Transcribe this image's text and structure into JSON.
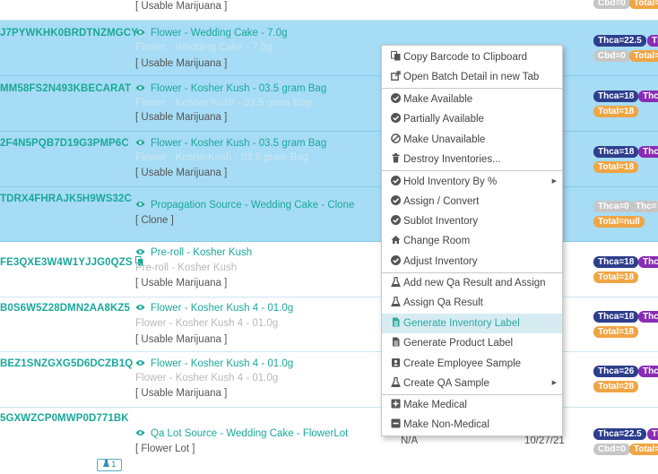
{
  "rows": [
    {
      "barcode": "",
      "name": "",
      "sub": "",
      "category": "[ Usable Marijuana ]",
      "selected": false,
      "badges": [
        {
          "text": "Cbd=0",
          "color": "grey"
        },
        {
          "text": "Total=",
          "color": "orange"
        }
      ]
    },
    {
      "barcode": "J7PYWKHK0BRDTNZMGCY",
      "name": "Flower - Wedding Cake - 7.0g",
      "sub": "Flower - Wedding Cake - 7.0g",
      "category": "[ Usable Marijuana ]",
      "selected": true,
      "badges": [
        {
          "text": "Thca=22.5",
          "color": "navy"
        },
        {
          "text": "Th",
          "color": "purple"
        },
        {
          "text": "Cbd=0",
          "color": "grey"
        },
        {
          "text": "Total=",
          "color": "orange"
        }
      ]
    },
    {
      "barcode": "MM58FS2N493KBECARAT",
      "name": "Flower - Kosher Kush - 03.5 gram Bag",
      "sub": "Flower - Kosher Kush - 03.5 gram Bag",
      "category": "[ Usable Marijuana ]",
      "selected": true,
      "badges": [
        {
          "text": "Thca=18",
          "color": "navy"
        },
        {
          "text": "Thc",
          "color": "purple"
        },
        {
          "text": "Total=18",
          "color": "orange"
        }
      ]
    },
    {
      "barcode": "2F4N5PQB7D19G3PMP6C",
      "name": "Flower - Kosher Kush - 03.5 gram Bag",
      "sub": "Flower - KosherKush - 03.5 gram Bag",
      "category": "[ Usable Marijuana ]",
      "selected": true,
      "badges": [
        {
          "text": "Thca=18",
          "color": "navy"
        },
        {
          "text": "Thc",
          "color": "purple"
        },
        {
          "text": "Total=18",
          "color": "orange"
        }
      ]
    },
    {
      "barcode": "TDRX4FHRAJK5H9WS32C",
      "name": "Propagation Source - Wedding Cake - Clone",
      "sub": "",
      "category": "[ Clone ]",
      "selected": true,
      "badges": [
        {
          "text": "Thca=0",
          "color": "grey"
        },
        {
          "text": "Thc=",
          "color": "grey"
        },
        {
          "text": "Total=null",
          "color": "orange"
        }
      ]
    },
    {
      "barcode": "FE3QXE3W4W1YJJG0QZS",
      "name": "Pre-roll - Kosher Kush",
      "sub": "Pre-roll - Kosher Kush",
      "category": "[ Usable Marijuana ]",
      "selected": false,
      "badges": [
        {
          "text": "Thca=18",
          "color": "navy"
        },
        {
          "text": "Thc",
          "color": "purple"
        },
        {
          "text": "Total=18",
          "color": "orange"
        }
      ]
    },
    {
      "barcode": "B0S6W5Z28DMN2AA8KZ5",
      "name": "Flower - Kosher Kush 4 - 01.0g",
      "sub": "Flower - Kosher Kush 4 - 01.0g",
      "category": "[ Usable Marijuana ]",
      "selected": false,
      "badges": [
        {
          "text": "Thca=18",
          "color": "navy"
        },
        {
          "text": "Thc",
          "color": "purple"
        },
        {
          "text": "Total=18",
          "color": "orange"
        }
      ]
    },
    {
      "barcode": "BEZ1SNZGXG5D6DCZB1Q",
      "name": "Flower - Kosher Kush 4 - 01.0g",
      "sub": "Flower - Kosher Kush 4 - 01.0g",
      "category": "[ Usable Marijuana ]",
      "selected": false,
      "badges": [
        {
          "text": "Thca=26",
          "color": "navy"
        },
        {
          "text": "Thc",
          "color": "purple"
        },
        {
          "text": "Total=28",
          "color": "orange"
        }
      ]
    },
    {
      "barcode": "5GXWZCP0MWP0D771BK",
      "name": "Qa Lot Source - Wedding Cake - FlowerLot",
      "sub": "",
      "category": "[ Flower Lot ]",
      "selected": false,
      "badges": [
        {
          "text": "Thca=22.5",
          "color": "navy"
        },
        {
          "text": "Th",
          "color": "purple"
        },
        {
          "text": "Cbd=0",
          "color": "grey"
        },
        {
          "text": "Total=",
          "color": "orange"
        }
      ]
    }
  ],
  "last_row_extra": {
    "na": "N/A",
    "date": "10/27/21",
    "sample_badge": "1"
  },
  "context_menu": {
    "items": [
      {
        "label": "Copy Barcode to Clipboard",
        "icon": "copy-icon"
      },
      {
        "label": "Open Batch Detail in new Tab",
        "icon": "external-link-icon"
      },
      {
        "label": "Make Available",
        "icon": "check-circle-icon"
      },
      {
        "label": "Partially Available",
        "icon": "check-circle-icon"
      },
      {
        "label": "Make Unavailable",
        "icon": "ban-icon"
      },
      {
        "label": "Destroy Inventories...",
        "icon": "trash-icon"
      },
      {
        "label": "Hold Inventory By %",
        "icon": "check-circle-icon",
        "submenu": true
      },
      {
        "label": "Assign / Convert",
        "icon": "check-circle-icon"
      },
      {
        "label": "Sublot Inventory",
        "icon": "check-circle-icon"
      },
      {
        "label": "Change Room",
        "icon": "home-icon"
      },
      {
        "label": "Adjust Inventory",
        "icon": "check-circle-icon"
      },
      {
        "label": "Add new Qa Result and Assign",
        "icon": "flask-icon"
      },
      {
        "label": "Assign Qa Result",
        "icon": "flask-icon"
      },
      {
        "label": "Generate Inventory Label",
        "icon": "file-icon",
        "highlighted": true
      },
      {
        "label": "Generate Product Label",
        "icon": "file-icon"
      },
      {
        "label": "Create Employee Sample",
        "icon": "id-badge-icon"
      },
      {
        "label": "Create QA Sample",
        "icon": "flask-icon",
        "submenu": true
      },
      {
        "label": "Make Medical",
        "icon": "plus-square-icon"
      },
      {
        "label": "Make Non-Medical",
        "icon": "minus-square-icon"
      }
    ]
  },
  "colors": {
    "accent": "#1aa89a",
    "selected_row": "#a6dcf5",
    "badge_navy": "#2d3e8c",
    "badge_purple": "#8a2bb4",
    "badge_orange": "#f0a544",
    "badge_grey": "#c6c6c6"
  }
}
